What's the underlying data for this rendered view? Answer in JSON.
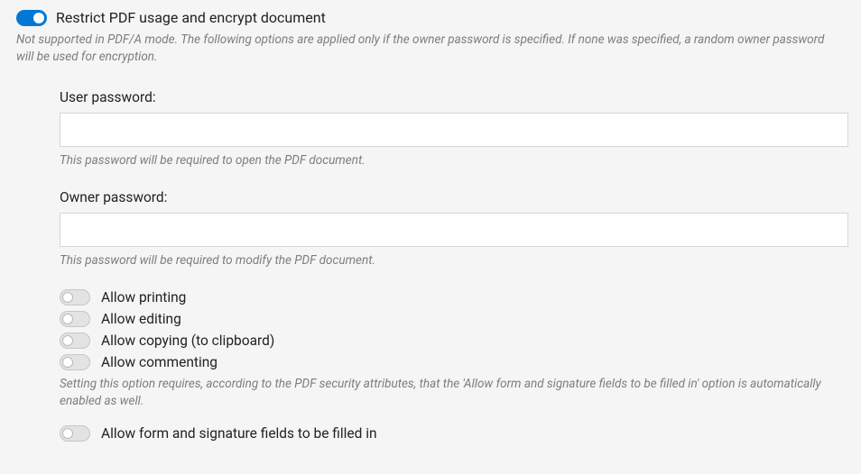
{
  "header": {
    "toggle_on": true,
    "label": "Restrict PDF usage and encrypt document",
    "help_text": "Not supported in PDF/A mode. The following options are applied only if the owner password is specified. If none was specified, a random owner password will be used for encryption."
  },
  "user_password": {
    "label": "User password:",
    "value": "",
    "help": "This password will be required to open the PDF document."
  },
  "owner_password": {
    "label": "Owner password:",
    "value": "",
    "help": "This password will be required to modify the PDF document."
  },
  "allow_printing": {
    "label": "Allow printing",
    "on": false
  },
  "allow_editing": {
    "label": "Allow editing",
    "on": false
  },
  "allow_copying": {
    "label": "Allow copying (to clipboard)",
    "on": false
  },
  "allow_commenting": {
    "label": "Allow commenting",
    "on": false
  },
  "commenting_help": "Setting this option requires, according to the PDF security attributes, that the 'Allow form and signature fields to be filled in' option is automatically enabled as well.",
  "allow_form_fill": {
    "label": "Allow form and signature fields to be filled in",
    "on": false
  }
}
